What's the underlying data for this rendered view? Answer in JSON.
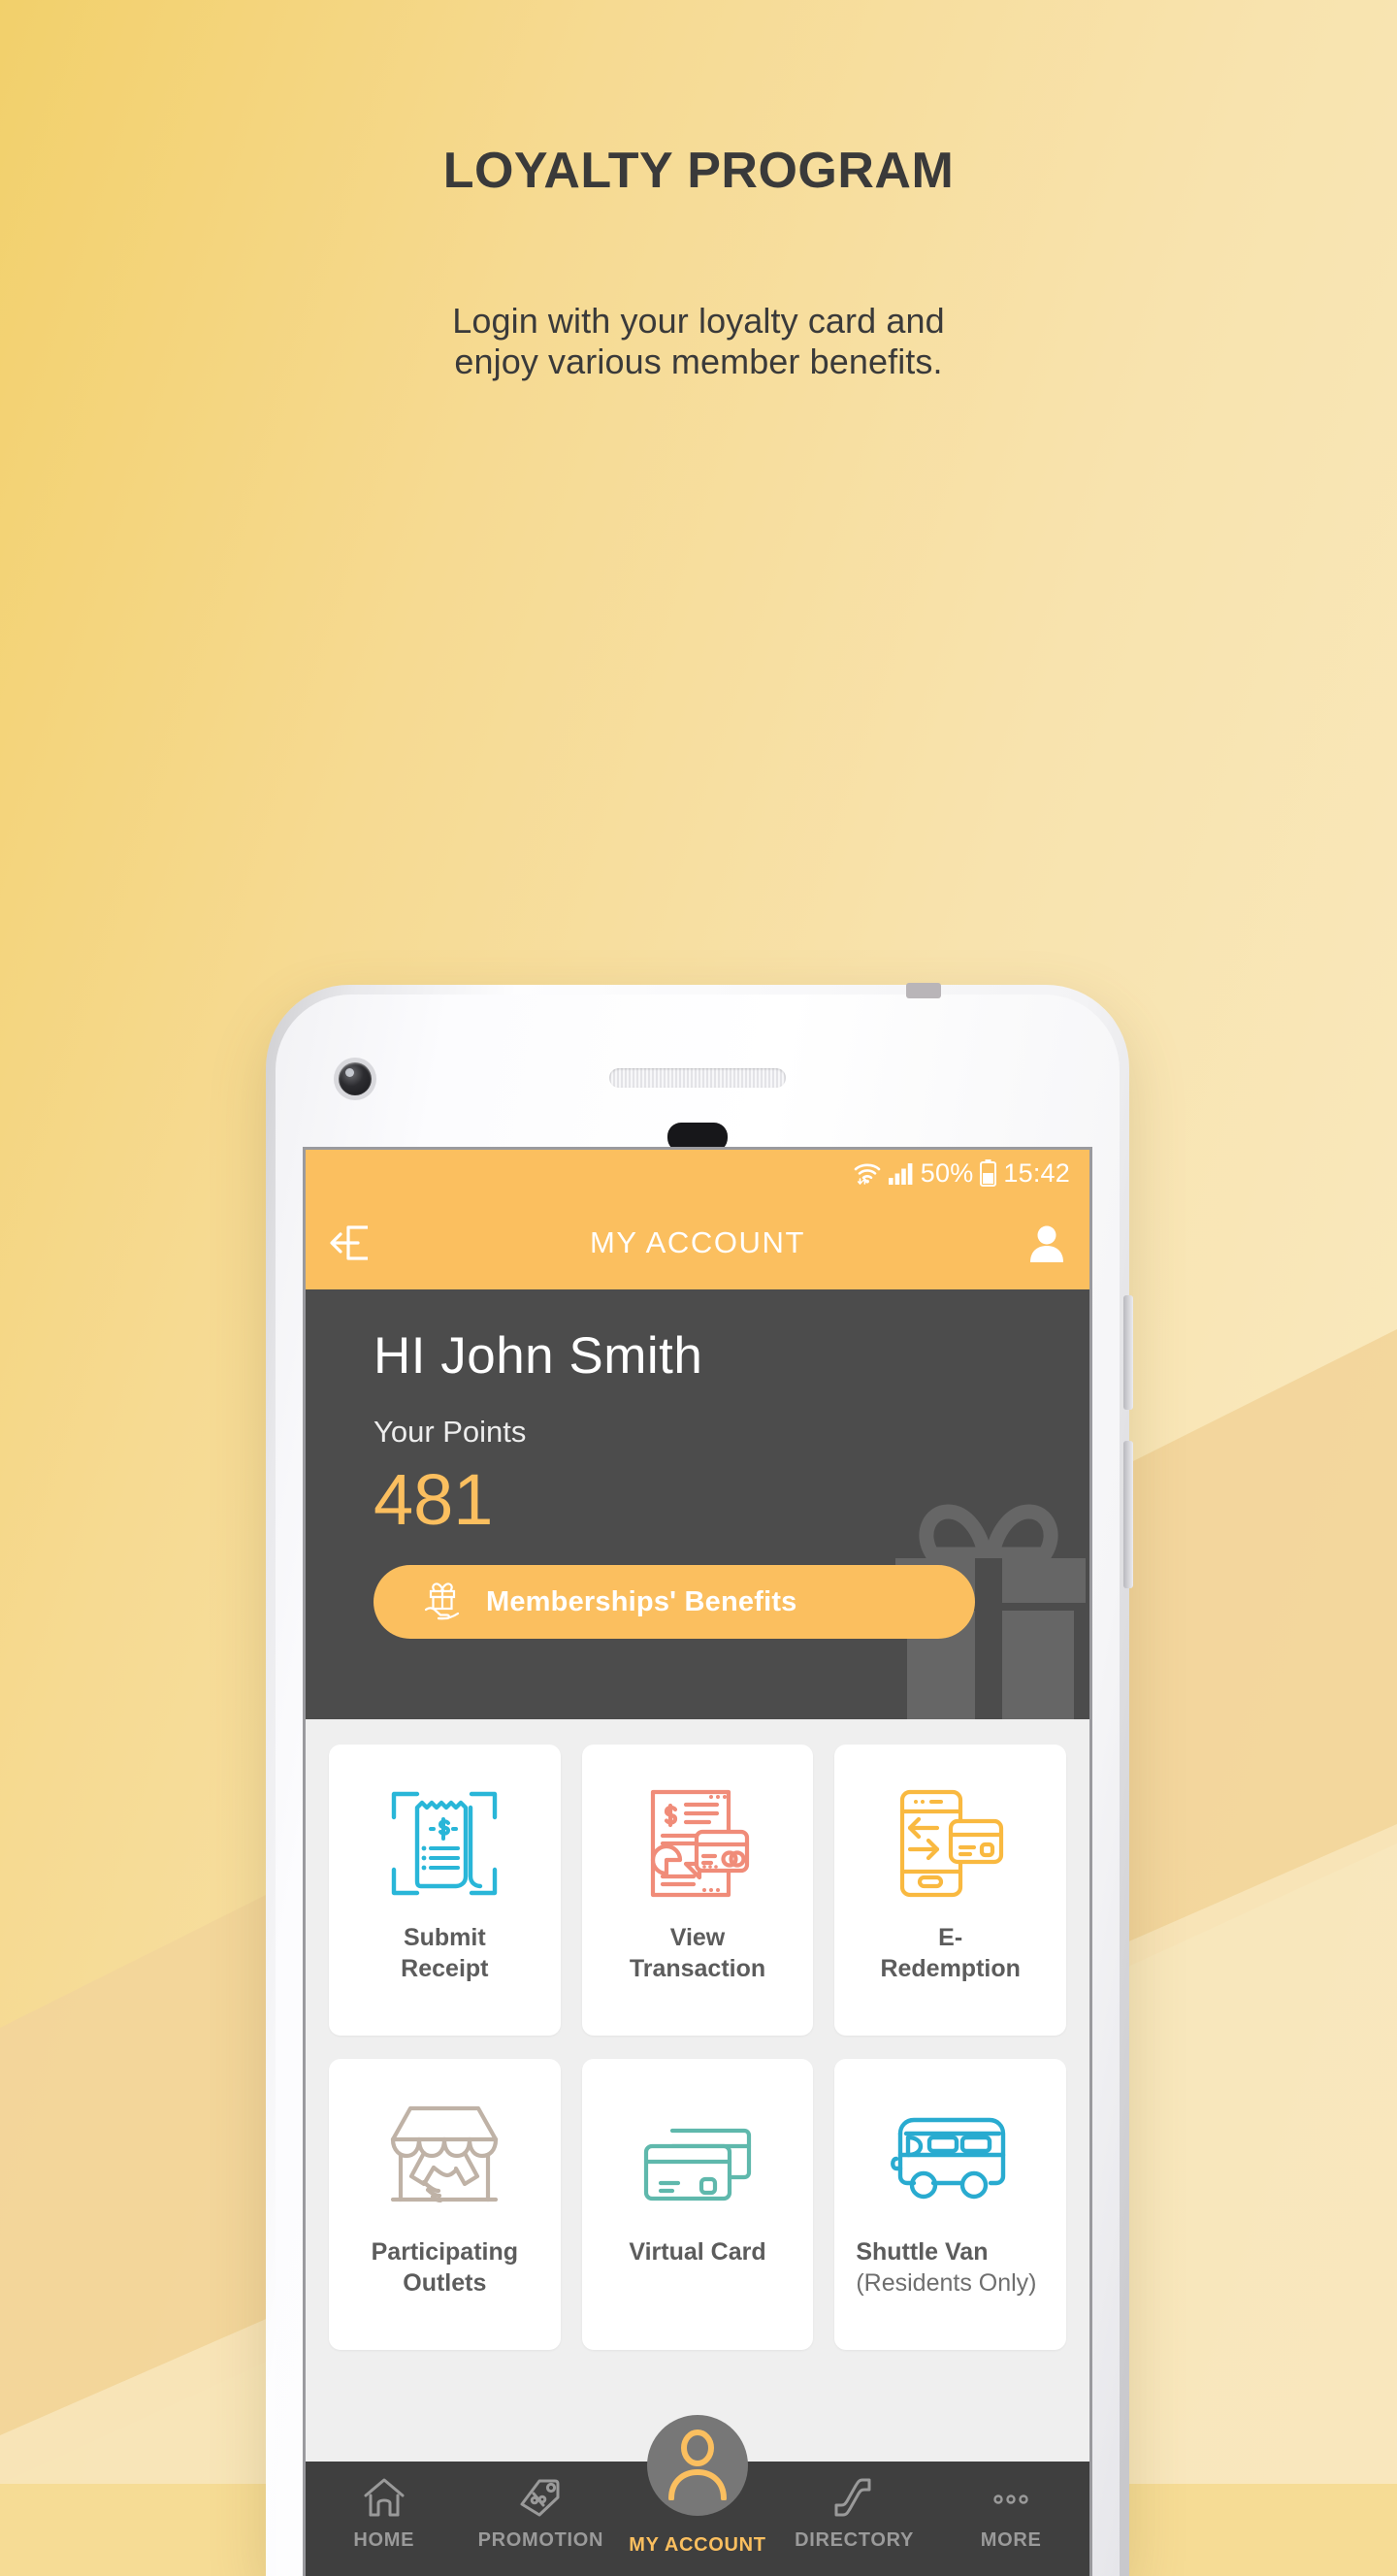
{
  "hero": {
    "title": "LOYALTY PROGRAM",
    "subtitle_line1": "Login with your loyalty card and",
    "subtitle_line2": "enjoy various member benefits."
  },
  "colors": {
    "accent_orange": "#FBBF5F",
    "dark_panel": "#4C4C4C",
    "nav_bar": "#3F3F3F",
    "screen_bg": "#EFEFEF",
    "bg_light": "#FAEBC4",
    "bg_deep": "#F2D06B",
    "bg_band": "#F2D59A",
    "icon_cyan": "#29B6D8",
    "icon_coral": "#F08C79",
    "icon_amber": "#F9B940",
    "icon_taupe": "#BFB2A6",
    "icon_teal": "#5FB8AC",
    "icon_blue": "#29ABD0"
  },
  "phone": {
    "statusbar": {
      "wifi_icon": "wifi-icon",
      "signal_icon": "signal-bars-icon",
      "battery_percent": "50%",
      "battery_icon": "battery-half-icon",
      "time": "15:42"
    },
    "appbar": {
      "back_icon": "logout-arrow-icon",
      "title": "MY ACCOUNT",
      "profile_icon": "person-icon"
    },
    "profile": {
      "greeting": "HI John Smith",
      "points_label": "Your Points",
      "points_value": "481",
      "benefits_button": {
        "label": "Memberships' Benefits",
        "icon": "gift-in-hand-icon"
      },
      "watermark_icon": "gift-box-icon"
    },
    "tiles": [
      {
        "label": "Submit",
        "label2": "Receipt",
        "sub": "",
        "icon": "receipt-scan-icon",
        "align": "center"
      },
      {
        "label": "View",
        "label2": "Transaction",
        "sub": "",
        "icon": "transaction-document-card-icon",
        "align": "center"
      },
      {
        "label": "E-",
        "label2": "Redemption",
        "sub": "",
        "icon": "phone-card-exchange-icon",
        "align": "center"
      },
      {
        "label": "Participating",
        "label2": "Outlets",
        "sub": "",
        "icon": "shop-handshake-icon",
        "align": "center"
      },
      {
        "label": "Virtual Card",
        "label2": "",
        "sub": "",
        "icon": "credit-cards-icon",
        "align": "center"
      },
      {
        "label": "Shuttle Van",
        "label2": "",
        "sub": "(Residents Only)",
        "icon": "van-icon",
        "align": "left"
      }
    ],
    "bottom_nav": [
      {
        "label": "HOME",
        "icon": "house-icon",
        "active": false
      },
      {
        "label": "PROMOTION",
        "icon": "price-tag-icon",
        "active": false
      },
      {
        "label": "MY ACCOUNT",
        "icon": "person-circle-icon",
        "active": true
      },
      {
        "label": "DIRECTORY",
        "icon": "escalator-icon",
        "active": false
      },
      {
        "label": "MORE",
        "icon": "three-dots-icon",
        "active": false
      }
    ]
  }
}
